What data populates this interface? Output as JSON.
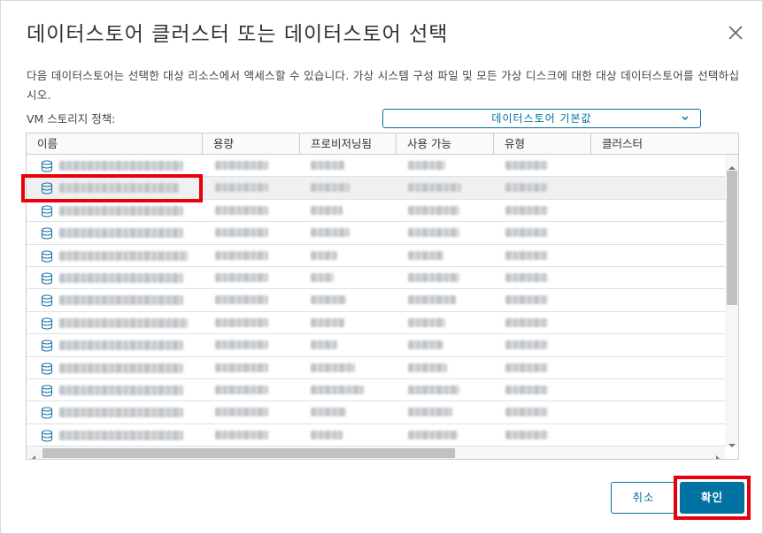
{
  "dialog": {
    "title": "데이터스토어 클러스터 또는 데이터스토어 선택",
    "description": "다음 데이터스토어는 선택한 대상 리소스에서 액세스할 수 있습니다. 가상 시스템 구성 파일 및 모든 가상 디스크에 대한 대상 데이터스토어를 선택하십시오.",
    "close_icon": "close-icon"
  },
  "policy": {
    "label": "VM 스토리지 정책:",
    "selected": "데이터스토어 기본값"
  },
  "grid": {
    "columns": [
      "이름",
      "용량",
      "프로비저닝됨",
      "사용 가능",
      "유형",
      "클러스터"
    ],
    "rows": [
      {
        "name": "Datastore-01",
        "capacity": "xxx.xx TB",
        "provisioned": "x.xx TB",
        "free": "x.xx TB",
        "type": "VMFS 6"
      },
      {
        "name": "Datastore-02",
        "capacity": "xxx.xx TB",
        "provisioned": "x.xx TB",
        "free": "xxx.xx TB",
        "type": "VMFS 6"
      },
      {
        "name": "Datastore-03",
        "capacity": "xxx.xx TB",
        "provisioned": "x.xx TB",
        "free": "xxx.xx TB",
        "type": "VMFS 6"
      },
      {
        "name": "Datastore-04",
        "capacity": "xxx.xx TB",
        "provisioned": "x.xx TB",
        "free": "x.xx TB",
        "type": "VMFS 6"
      },
      {
        "name": "Datastore-05",
        "capacity": "xxx.xx TB",
        "provisioned": "x.xx TB",
        "free": "x.xx TB",
        "type": "VMFS 6"
      },
      {
        "name": "Datastore-06",
        "capacity": "xxx.xx TB",
        "provisioned": "x.xx TB",
        "free": "xxx.xx TB",
        "type": "VMFS 6"
      },
      {
        "name": "Datastore-07",
        "capacity": "xxx.xx TB",
        "provisioned": "x.xx TB",
        "free": "x.xx TB",
        "type": "VMFS 6"
      },
      {
        "name": "Datastore-08",
        "capacity": "xxx.xx TB",
        "provisioned": "x.xx TB",
        "free": "x.xx TB",
        "type": "VMFS 6"
      },
      {
        "name": "Datastore-09",
        "capacity": "xxx.xx TB",
        "provisioned": "x.xx TB",
        "free": "x.xx TB",
        "type": "VMFS 6"
      },
      {
        "name": "Datastore-10",
        "capacity": "xxx.xx TB",
        "provisioned": "xxx.xx TB",
        "free": "x.xx TB",
        "type": "VMFS 6"
      },
      {
        "name": "Datastore-11",
        "capacity": "xxx.xx TB",
        "provisioned": "x.xx TB",
        "free": "xxx.xx TB",
        "type": "VMFS 6"
      },
      {
        "name": "Datastore-12",
        "capacity": "xxx.xx TB",
        "provisioned": "x.xx TB",
        "free": "x.xx TB",
        "type": "VMFS 6"
      },
      {
        "name": "Datastore-13",
        "capacity": "xxx.xx TB",
        "provisioned": "x.xx TB",
        "free": "x.xx TB",
        "type": "VMFS 6"
      }
    ]
  },
  "buttons": {
    "cancel": "취소",
    "ok": "확인"
  },
  "colors": {
    "accent": "#0072a3",
    "highlight": "#e8000a"
  }
}
